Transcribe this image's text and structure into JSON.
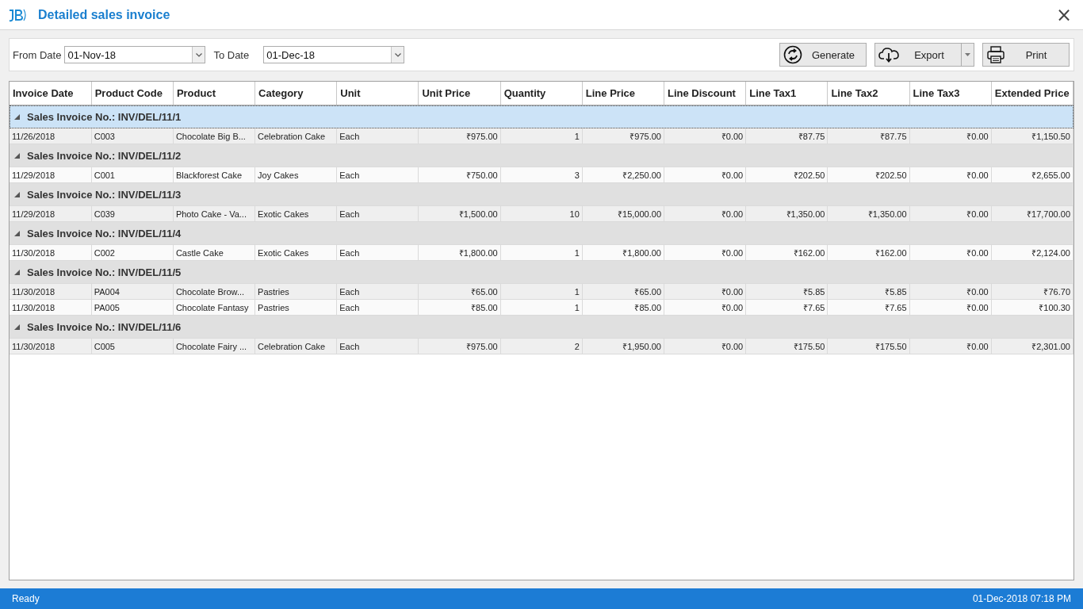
{
  "window": {
    "title": "Detailed sales invoice",
    "close": "×"
  },
  "filters": [
    {
      "label": "From Date",
      "value": "01-Nov-18"
    },
    {
      "label": "To Date",
      "value": "01-Dec-18"
    }
  ],
  "buttons": [
    {
      "label": "Generate",
      "kind": "generate",
      "dropdown": false
    },
    {
      "label": "Export",
      "kind": "export",
      "dropdown": true
    },
    {
      "label": "Print",
      "kind": "print",
      "dropdown": false
    }
  ],
  "table": {
    "columns": [
      {
        "label": "Invoice Date",
        "kind": "text"
      },
      {
        "label": "Product Code",
        "kind": "text"
      },
      {
        "label": "Product",
        "kind": "text"
      },
      {
        "label": "Category",
        "kind": "text"
      },
      {
        "label": "Unit",
        "kind": "text"
      },
      {
        "label": "Unit Price",
        "kind": "number"
      },
      {
        "label": "Quantity",
        "kind": "number"
      },
      {
        "label": "Line Price",
        "kind": "number"
      },
      {
        "label": "Line Discount",
        "kind": "number"
      },
      {
        "label": "Line Tax1",
        "kind": "number"
      },
      {
        "label": "Line Tax2",
        "kind": "number"
      },
      {
        "label": "Line Tax3",
        "kind": "number"
      },
      {
        "label": "Extended Price",
        "kind": "number"
      }
    ],
    "groups": [
      {
        "label": "Sales Invoice No.: INV/DEL/11/1",
        "selected": true,
        "expanded": true,
        "rows": [
          [
            "11/26/2018",
            "C003",
            "Chocolate Big B...",
            "Celebration Cake",
            "Each",
            "₹975.00",
            "1",
            "₹975.00",
            "₹0.00",
            "₹87.75",
            "₹87.75",
            "₹0.00",
            "₹1,150.50"
          ]
        ]
      },
      {
        "label": "Sales Invoice No.: INV/DEL/11/2",
        "selected": false,
        "expanded": true,
        "rows": [
          [
            "11/29/2018",
            "C001",
            "Blackforest Cake",
            "Joy Cakes",
            "Each",
            "₹750.00",
            "3",
            "₹2,250.00",
            "₹0.00",
            "₹202.50",
            "₹202.50",
            "₹0.00",
            "₹2,655.00"
          ]
        ]
      },
      {
        "label": "Sales Invoice No.: INV/DEL/11/3",
        "selected": false,
        "expanded": true,
        "rows": [
          [
            "11/29/2018",
            "C039",
            "Photo Cake - Va...",
            "Exotic Cakes",
            "Each",
            "₹1,500.00",
            "10",
            "₹15,000.00",
            "₹0.00",
            "₹1,350.00",
            "₹1,350.00",
            "₹0.00",
            "₹17,700.00"
          ]
        ]
      },
      {
        "label": "Sales Invoice No.: INV/DEL/11/4",
        "selected": false,
        "expanded": true,
        "rows": [
          [
            "11/30/2018",
            "C002",
            "Castle Cake",
            "Exotic Cakes",
            "Each",
            "₹1,800.00",
            "1",
            "₹1,800.00",
            "₹0.00",
            "₹162.00",
            "₹162.00",
            "₹0.00",
            "₹2,124.00"
          ]
        ]
      },
      {
        "label": "Sales Invoice No.: INV/DEL/11/5",
        "selected": false,
        "expanded": true,
        "rows": [
          [
            "11/30/2018",
            "PA004",
            "Chocolate Brow...",
            "Pastries",
            "Each",
            "₹65.00",
            "1",
            "₹65.00",
            "₹0.00",
            "₹5.85",
            "₹5.85",
            "₹0.00",
            "₹76.70"
          ],
          [
            "11/30/2018",
            "PA005",
            "Chocolate Fantasy",
            "Pastries",
            "Each",
            "₹85.00",
            "1",
            "₹85.00",
            "₹0.00",
            "₹7.65",
            "₹7.65",
            "₹0.00",
            "₹100.30"
          ]
        ]
      },
      {
        "label": "Sales Invoice No.: INV/DEL/11/6",
        "selected": false,
        "expanded": true,
        "rows": [
          [
            "11/30/2018",
            "C005",
            "Chocolate Fairy ...",
            "Celebration Cake",
            "Each",
            "₹975.00",
            "2",
            "₹1,950.00",
            "₹0.00",
            "₹175.50",
            "₹175.50",
            "₹0.00",
            "₹2,301.00"
          ]
        ]
      }
    ]
  },
  "status_bar": {
    "status": "Ready",
    "datetime": "01-Dec-2018 07:18 PM"
  }
}
